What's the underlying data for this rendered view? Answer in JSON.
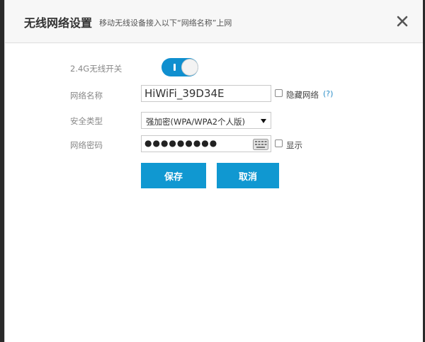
{
  "header": {
    "title": "无线网络设置",
    "subtitle": "移动无线设备接入以下“网络名称”上网",
    "close_icon": "close-icon"
  },
  "form": {
    "wifi_toggle": {
      "label": "2.4G无线开关",
      "enabled": true,
      "accent": "#0f8fcf"
    },
    "network_name": {
      "label": "网络名称",
      "value": "HiWiFi_39D34E"
    },
    "hide_network": {
      "label": "隐藏网络",
      "checked": false,
      "help": "(?)"
    },
    "security_type": {
      "label": "安全类型",
      "selected": "强加密(WPA/WPA2个人版)"
    },
    "password": {
      "label": "网络密码",
      "masked_value": "●●●●●●●●●",
      "keyboard_icon": "keyboard-icon"
    },
    "show_password": {
      "label": "显示",
      "checked": false
    }
  },
  "actions": {
    "save_label": "保存",
    "cancel_label": "取消",
    "button_color": "#1098d1"
  }
}
